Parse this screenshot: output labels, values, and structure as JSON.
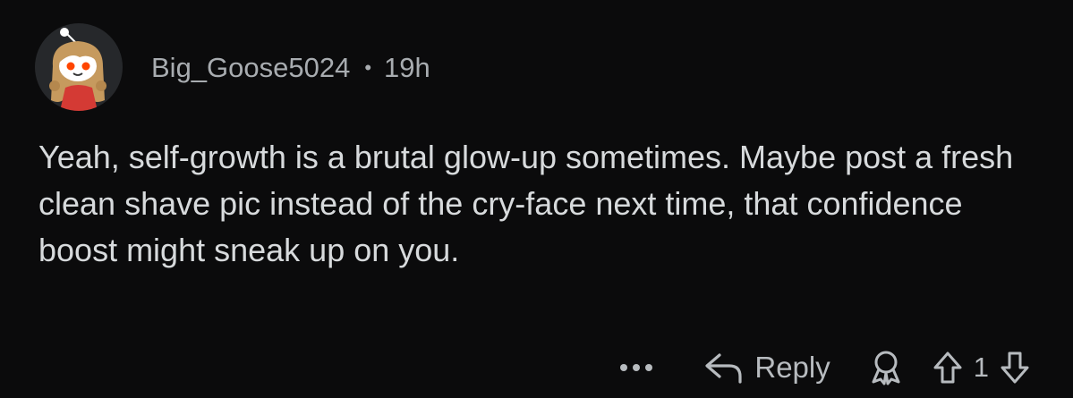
{
  "comment": {
    "author": "Big_Goose5024",
    "separator": "•",
    "age": "19h",
    "body": "Yeah, self-growth is a brutal glow-up sometimes. Maybe post a fresh clean shave pic instead of the cry-face next time, that confidence boost might sneak up on you.",
    "avatar_icon": "snoo-avatar-icon"
  },
  "actions": {
    "more_icon": "ellipsis-icon",
    "reply_label": "Reply",
    "reply_icon": "reply-arrow-icon",
    "award_icon": "award-icon",
    "upvote_icon": "upvote-arrow-icon",
    "vote_count": "1",
    "downvote_icon": "downvote-arrow-icon"
  },
  "colors": {
    "background": "#0b0b0c",
    "text_primary": "#d7dadc",
    "text_secondary": "#a8acb0",
    "avatar_bg": "#26282b",
    "avatar_shirt": "#d43a34",
    "avatar_hair": "#c69a5e"
  }
}
